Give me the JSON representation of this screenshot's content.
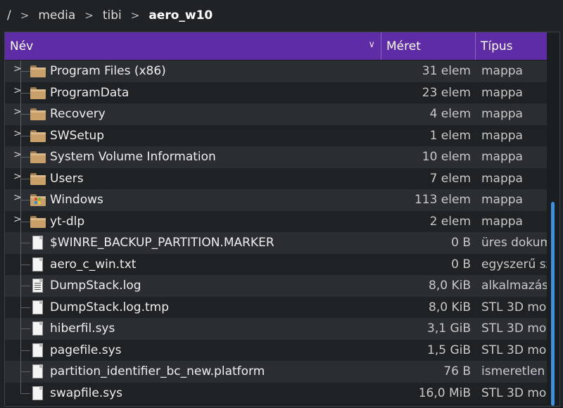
{
  "breadcrumb": {
    "root": "/",
    "items": [
      {
        "label": "media"
      },
      {
        "label": "tibi"
      }
    ],
    "current": "aero_w10"
  },
  "columns": {
    "name": "Név",
    "size": "Méret",
    "type": "Típus"
  },
  "rows": [
    {
      "name": "Program Files (x86)",
      "size": "31 elem",
      "type": "mappa",
      "kind": "folder"
    },
    {
      "name": "ProgramData",
      "size": "23 elem",
      "type": "mappa",
      "kind": "folder"
    },
    {
      "name": "Recovery",
      "size": "4 elem",
      "type": "mappa",
      "kind": "folder"
    },
    {
      "name": "SWSetup",
      "size": "1 elem",
      "type": "mappa",
      "kind": "folder"
    },
    {
      "name": "System Volume Information",
      "size": "10 elem",
      "type": "mappa",
      "kind": "folder"
    },
    {
      "name": "Users",
      "size": "7 elem",
      "type": "mappa",
      "kind": "folder"
    },
    {
      "name": "Windows",
      "size": "113 elem",
      "type": "mappa",
      "kind": "windows-folder"
    },
    {
      "name": "yt-dlp",
      "size": "2 elem",
      "type": "mappa",
      "kind": "folder"
    },
    {
      "name": "$WINRE_BACKUP_PARTITION.MARKER",
      "size": "0 B",
      "type": "üres dokum",
      "kind": "file"
    },
    {
      "name": "aero_c_win.txt",
      "size": "0 B",
      "type": "egyszerű sz",
      "kind": "file"
    },
    {
      "name": "DumpStack.log",
      "size": "8,0 KiB",
      "type": "alkalmazás",
      "kind": "log"
    },
    {
      "name": "DumpStack.log.tmp",
      "size": "8,0 KiB",
      "type": "STL 3D mo",
      "kind": "file"
    },
    {
      "name": "hiberfil.sys",
      "size": "3,1 GiB",
      "type": "STL 3D mo",
      "kind": "file"
    },
    {
      "name": "pagefile.sys",
      "size": "1,5 GiB",
      "type": "STL 3D mo",
      "kind": "file"
    },
    {
      "name": "partition_identifier_bc_new.platform",
      "size": "76 B",
      "type": "ismeretlen",
      "kind": "file"
    },
    {
      "name": "swapfile.sys",
      "size": "16,0 MiB",
      "type": "STL 3D mo",
      "kind": "file"
    }
  ],
  "colors": {
    "header": "#5e2ca5",
    "scrollbar": "#3d8fe0",
    "folder": "#c9a06a"
  }
}
